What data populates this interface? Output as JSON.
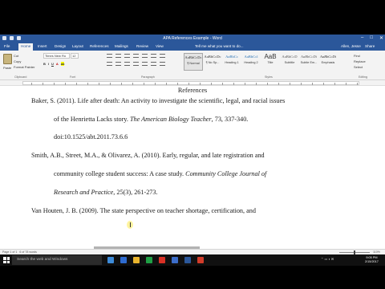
{
  "window": {
    "title": "APA References Example - Word",
    "controls": [
      "–",
      "□",
      "✕"
    ]
  },
  "tabs": {
    "items": [
      "File",
      "Home",
      "Insert",
      "Design",
      "Layout",
      "References",
      "Mailings",
      "Review",
      "View"
    ],
    "active": "Home",
    "tell_me": "Tell me what you want to do...",
    "user": "Allen, Jesse",
    "share": "Share"
  },
  "ribbon": {
    "clipboard": {
      "paste": "Paste",
      "cut": "Cut",
      "copy": "Copy",
      "format_painter": "Format Painter",
      "label": "Clipboard"
    },
    "font": {
      "name": "Times New Ro",
      "size": "12",
      "bold": "B",
      "italic": "I",
      "underline": "U",
      "label": "Font"
    },
    "paragraph": {
      "label": "Paragraph"
    },
    "styles": {
      "label": "Styles",
      "items": [
        {
          "sample": "AaBbCcDc",
          "name": "¶ Normal"
        },
        {
          "sample": "AaBbCcDc",
          "name": "¶ No Sp..."
        },
        {
          "sample": "AaBbCc",
          "name": "Heading 1"
        },
        {
          "sample": "AaBbCcl",
          "name": "Heading 2"
        },
        {
          "sample": "AaB",
          "name": "Title"
        },
        {
          "sample": "AaBbCcD",
          "name": "Subtitle"
        },
        {
          "sample": "AaBbCcDi",
          "name": "Subtle Em..."
        },
        {
          "sample": "AaBbCcDi",
          "name": "Emphasis"
        }
      ]
    },
    "editing": {
      "find": "Find",
      "replace": "Replace",
      "select": "Select",
      "label": "Editing"
    }
  },
  "document": {
    "heading": "References",
    "lines": [
      {
        "parts": [
          {
            "t": "Baker, S. (2011). Life after death: An activity to investigate the scientific, legal, and racial issues",
            "i": false
          }
        ]
      },
      {
        "parts": [
          {
            "t": "of the Henrietta Lacks story. ",
            "i": false
          },
          {
            "t": "The American Biology Teacher",
            "i": true
          },
          {
            "t": ", 73, 337-340.",
            "i": false
          }
        ]
      },
      {
        "parts": [
          {
            "t": "doi:10.1525/abt.2011.73.6.6",
            "i": false
          }
        ]
      },
      {
        "parts": [
          {
            "t": "Smith, A.B., Street, M.A., & Olivarez, A. (2010). Early, regular, and late registration and",
            "i": false
          }
        ]
      },
      {
        "parts": [
          {
            "t": "community college student success: A case study. ",
            "i": false
          },
          {
            "t": "Community College Journal of",
            "i": true
          }
        ]
      },
      {
        "parts": [
          {
            "t": "Research and Practice",
            "i": true
          },
          {
            "t": ", 25(3), 261-273.",
            "i": false
          }
        ]
      },
      {
        "parts": [
          {
            "t": "Van Houten, J. B. (2009). The state perspective on teacher shortage, certification, and",
            "i": false
          }
        ]
      }
    ]
  },
  "status": {
    "page": "Page 1 of 1",
    "words": "6 of 78 words",
    "zoom": "110%"
  },
  "taskbar": {
    "search_placeholder": "Search the web and Windows",
    "time": "9:05 PM",
    "date": "2/15/2017",
    "icon_colors": [
      "#3d8bd8",
      "#2e6bd0",
      "#e9b42d",
      "#1fa045",
      "#d93025",
      "#3c6dc9",
      "#2b579a",
      "#d23c2a"
    ]
  }
}
